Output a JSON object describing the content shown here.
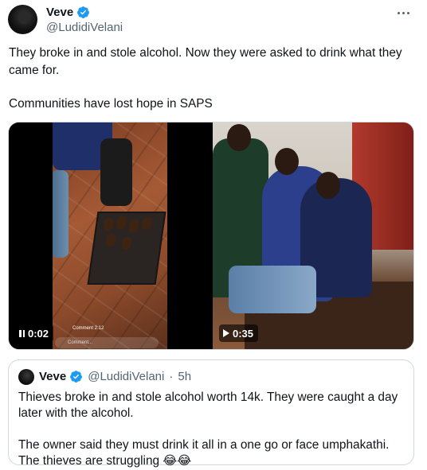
{
  "tweet": {
    "author_name": "Veve",
    "author_handle": "@LudidiVelani",
    "verified_icon": "verified-badge-icon",
    "more_icon": "more-options-icon",
    "text_line1": "They broke in and stole alcohol. Now they were asked to drink what they came for.",
    "text_line2": "Communities have lost hope in SAPS"
  },
  "media": {
    "video_left": {
      "time": "0:02",
      "state": "playing",
      "icon": "pause-icon",
      "overlay_label": "Comment...",
      "overlay_live_text": "Comment 2:12"
    },
    "video_right": {
      "time": "0:35",
      "state": "paused",
      "icon": "play-icon"
    }
  },
  "quote": {
    "author_name": "Veve",
    "author_handle": "@LudidiVelani",
    "separator": "·",
    "time_ago": "5h",
    "text_line1": "Thieves broke in and stole alcohol worth 14k. They were caught a day later with the alcohol.",
    "text_line2": "The owner said they must drink it all in a one go or face umphakathi. The thieves are struggling 😂😂"
  },
  "colors": {
    "text_primary": "#0f1419",
    "text_secondary": "#536471",
    "verified_blue": "#1d9bf0",
    "border": "#cfd9de"
  }
}
